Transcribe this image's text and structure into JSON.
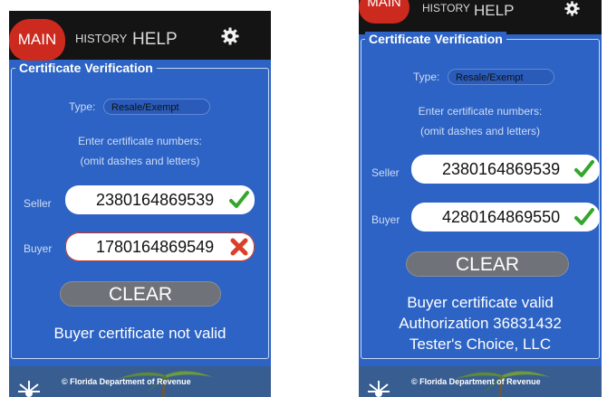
{
  "colors": {
    "panel_bg": "#2c63c4",
    "topbar_bg": "#141414",
    "main_tab": "#cc2a1e",
    "valid": "#35a62c",
    "invalid": "#d9402a",
    "clear_btn": "#6f7278"
  },
  "nav": {
    "main": "MAIN",
    "history": "HISTORY",
    "help": "HELP",
    "settings_icon": "gear-icon"
  },
  "screens": [
    {
      "section_title": "Certificate Verification",
      "type_label": "Type:",
      "type_value": "Resale/Exempt",
      "instruction_line1": "Enter certificate numbers:",
      "instruction_line2": "(omit dashes and letters)",
      "seller_label": "Seller",
      "seller_value": "2380164869539",
      "seller_status": "valid",
      "buyer_label": "Buyer",
      "buyer_value": "1780164869549",
      "buyer_status": "invalid",
      "clear_label": "CLEAR",
      "result_line1": "Buyer certificate not valid",
      "footer": "© Florida Department of Revenue"
    },
    {
      "section_title": "Certificate Verification",
      "type_label": "Type:",
      "type_value": "Resale/Exempt",
      "instruction_line1": "Enter certificate numbers:",
      "instruction_line2": "(omit dashes and letters)",
      "seller_label": "Seller",
      "seller_value": "2380164869539",
      "seller_status": "valid",
      "buyer_label": "Buyer",
      "buyer_value": "4280164869550",
      "buyer_status": "valid",
      "clear_label": "CLEAR",
      "result_line1": "Buyer certificate valid",
      "result_line2": "Authorization 36831432",
      "result_line3": "Tester's Choice, LLC",
      "footer": "© Florida Department of Revenue"
    }
  ]
}
